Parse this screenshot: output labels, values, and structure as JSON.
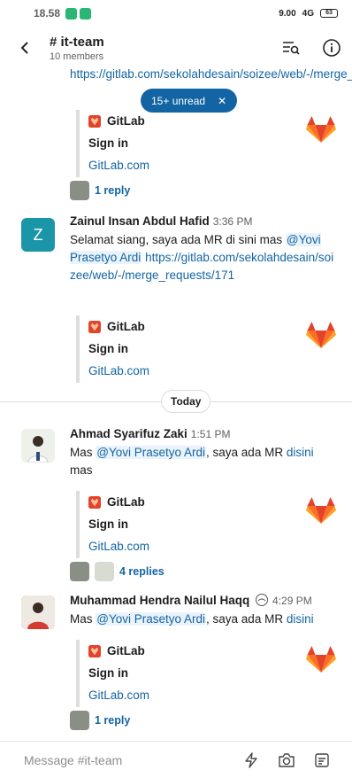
{
  "status_bar": {
    "time": "18.58",
    "speed": "9.00",
    "speed_unit": "KB/S",
    "network": "4G",
    "battery": "63"
  },
  "header": {
    "back_icon": "chevron-left-icon",
    "channel": "# it-team",
    "members": "10 members"
  },
  "unread_banner": {
    "label": "15+ unread",
    "close": "✕"
  },
  "messages": [
    {
      "text_partial": "https://gitlab.com/sekolahdesain/soizee/web/-/merge_requ",
      "attachment": {
        "title": "GitLab",
        "subtitle": "Sign in",
        "domain": "GitLab.com"
      },
      "reply": "1 reply"
    },
    {
      "author": "Zainul Insan Abdul Hafid",
      "avatar_initial": "Z",
      "time": "3:36 PM",
      "text": "Selamat siang, saya ada MR di sini mas ",
      "mention": "@Yovi Prasetyo Ardi",
      "link": "https://gitlab.com/sekolahdesain/soizee/web/-/merge_requests/171",
      "attachment": {
        "title": "GitLab",
        "subtitle": "Sign in",
        "domain": "GitLab.com"
      }
    },
    {
      "author": "Ahmad Syarifuz Zaki",
      "time": "1:51 PM",
      "text_before": "Mas ",
      "mention": "@Yovi Prasetyo Ardi",
      "text_after": ", saya ada MR ",
      "link_word": "disini",
      "text_end": "mas",
      "attachment": {
        "title": "GitLab",
        "subtitle": "Sign in",
        "domain": "GitLab.com"
      },
      "reply": "4 replies"
    },
    {
      "author": "Muhammad Hendra Nailul Haqq",
      "time": "4:29 PM",
      "text_before": "Mas ",
      "mention": "@Yovi Prasetyo Ardi",
      "text_after": ", saya ada MR ",
      "link_word": "disini",
      "attachment": {
        "title": "GitLab",
        "subtitle": "Sign in",
        "domain": "GitLab.com"
      },
      "reply": "1 reply"
    }
  ],
  "day_divider": "Today",
  "composer": {
    "placeholder": "Message #it-team"
  },
  "colors": {
    "link": "#1264a3",
    "gitlab_orange": "#fc6d26",
    "gitlab_red": "#e24329",
    "avatar_teal": "#1a96a8"
  }
}
